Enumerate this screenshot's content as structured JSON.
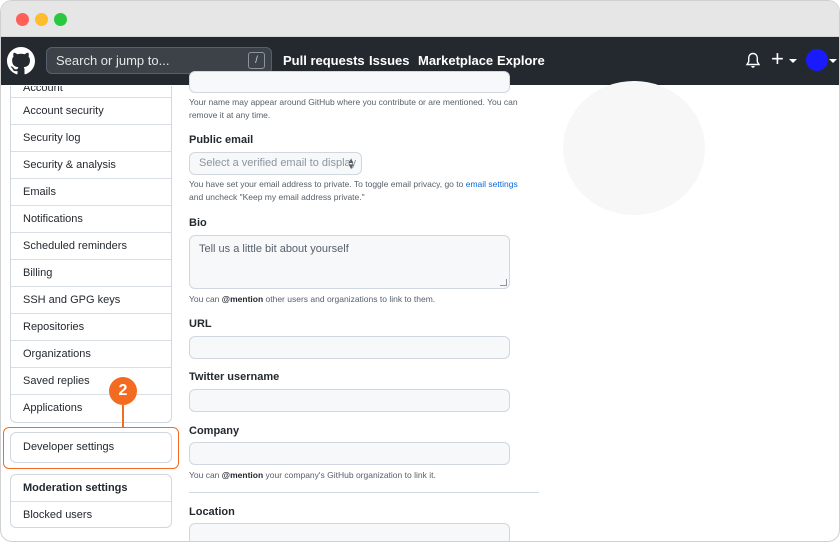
{
  "browser": {},
  "header": {
    "search_placeholder": "Search or jump to...",
    "slash_key": "/",
    "nav": [
      "Pull requests",
      "Issues",
      "Marketplace",
      "Explore"
    ],
    "plus": "+"
  },
  "sidebar": {
    "partial_item": "Account",
    "items": [
      "Account security",
      "Security log",
      "Security & analysis",
      "Emails",
      "Notifications",
      "Scheduled reminders",
      "Billing",
      "SSH and GPG keys",
      "Repositories",
      "Organizations",
      "Saved replies",
      "Applications"
    ],
    "developer_settings": "Developer settings",
    "moderation_settings": "Moderation settings",
    "blocked_users": "Blocked users"
  },
  "callout": {
    "number": "2",
    "color": "#f36b21"
  },
  "form": {
    "name_note": "Your name may appear around GitHub where you contribute or are mentioned. You can remove it at any time.",
    "public_email_label": "Public email",
    "public_email_select": "Select a verified email to display",
    "email_note_1": "You have set your email address to private. To toggle email privacy, go to",
    "email_settings_link": "email settings",
    "email_note_2": "and uncheck \"Keep my email address private.\"",
    "bio_label": "Bio",
    "bio_placeholder": "Tell us a little bit about yourself",
    "bio_note_mention": "@mention",
    "bio_note_prefix": "You can",
    "bio_note_suffix": "other users and organizations to link to them.",
    "url_label": "URL",
    "twitter_label": "Twitter username",
    "company_label": "Company",
    "company_note_prefix": "You can",
    "company_note_mention": "@mention",
    "company_note_suffix": "your company's GitHub organization to link it.",
    "location_label": "Location"
  },
  "colors": {
    "header_bg": "#24292f",
    "avatar": "#1a1aff",
    "link": "#0969da"
  }
}
